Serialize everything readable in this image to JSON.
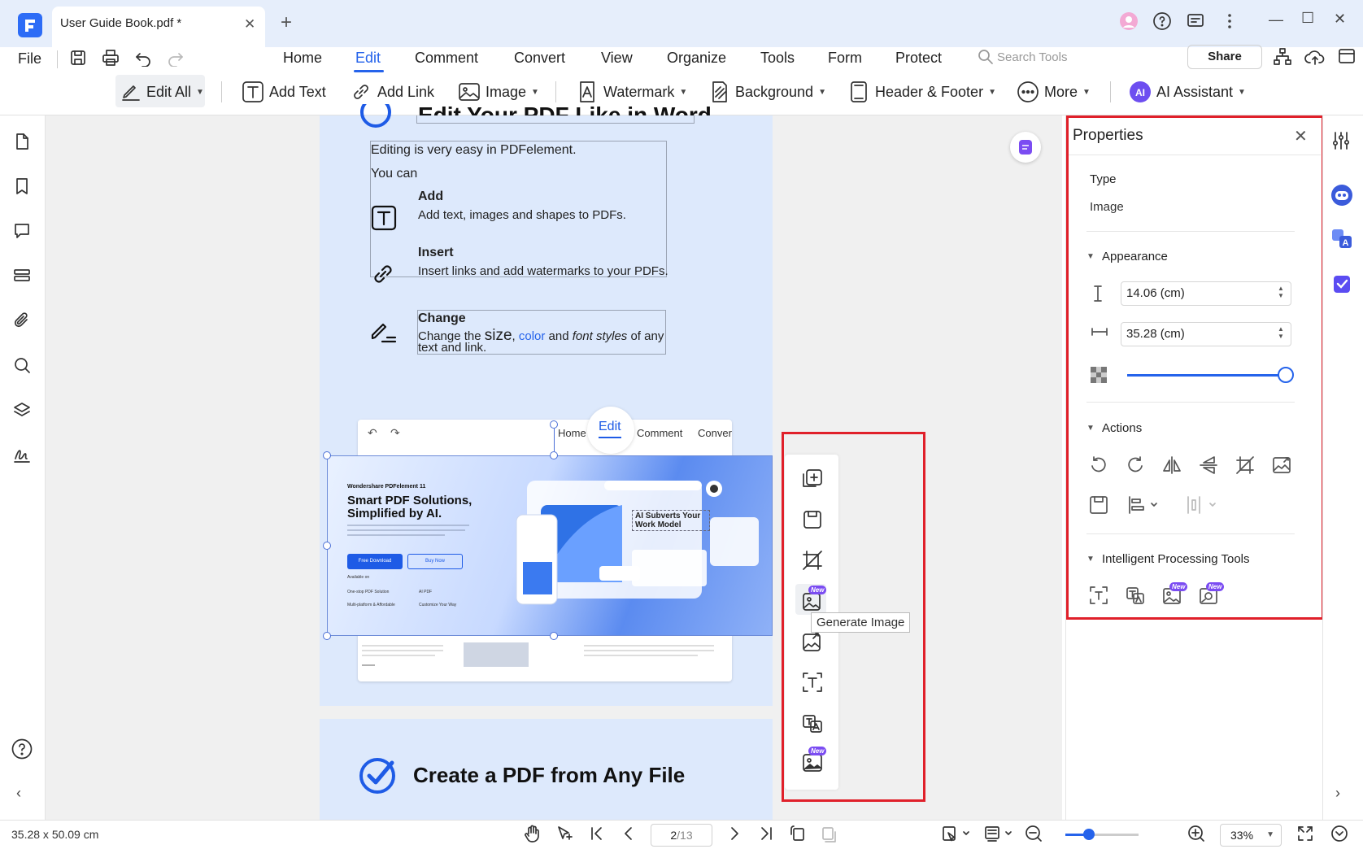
{
  "tab": {
    "title": "User Guide Book.pdf *",
    "close": "✕",
    "add": "+"
  },
  "window": {
    "minimize": "—",
    "maximize": "☐",
    "close": "✕"
  },
  "menubar": {
    "file": "File",
    "items": [
      "Home",
      "Edit",
      "Comment",
      "Convert",
      "View",
      "Organize",
      "Tools",
      "Form",
      "Protect"
    ],
    "active": "Edit",
    "search_placeholder": "Search Tools",
    "share": "Share"
  },
  "ribbon": {
    "edit_all": "Edit All",
    "add_text": "Add Text",
    "add_link": "Add Link",
    "image": "Image",
    "watermark": "Watermark",
    "background": "Background",
    "header_footer": "Header & Footer",
    "more": "More",
    "ai_assistant": "AI Assistant"
  },
  "page": {
    "heading_partial": "Edit Your PDF Like in Word",
    "intro1": "Editing is very easy in PDFelement.",
    "intro2": "You can",
    "add_title": "Add",
    "add_desc": "Add text, images and shapes to PDFs.",
    "insert_title": "Insert",
    "insert_desc": "Insert links and add watermarks to your PDFs.",
    "change_title": "Change",
    "change_pre": "Change the ",
    "change_size": "size",
    "change_comma": ", ",
    "change_color": "color",
    "change_and": " and ",
    "change_font": "font styles",
    "change_post": " of any",
    "change_line2": "text and link.",
    "mini_tabs": [
      "Home",
      "Edit",
      "Comment",
      "Convert"
    ],
    "banner": {
      "brand": "Wondershare PDFelement 11",
      "headline1": "Smart PDF Solutions,",
      "headline2": "Simplified by AI.",
      "free_download": "Free Download",
      "buy_now": "Buy Now",
      "available_on": "Available on",
      "feature1": "One-stop PDF Solution",
      "feature2": "AI PDF",
      "feature3": "Multi-platform & Affordable",
      "feature4": "Customize Your Way",
      "callout": "AI Subverts Your Work Model"
    },
    "page2_heading": "Create a PDF from Any File"
  },
  "float_toolbar": {
    "tooltip": "Generate Image",
    "new_badge": "New",
    "items": [
      "add-image",
      "save-image",
      "crop",
      "generate-image",
      "replace-image",
      "ocr-text",
      "translate-image",
      "ai-image"
    ]
  },
  "properties": {
    "title": "Properties",
    "close": "✕",
    "type_label": "Type",
    "type_value": "Image",
    "appearance": "Appearance",
    "height_value": "14.06 (cm)",
    "width_value": "35.28 (cm)",
    "opacity": 1.0,
    "actions": "Actions",
    "intelligent": "Intelligent Processing Tools",
    "new_badge": "New"
  },
  "statusbar": {
    "dimensions": "35.28 x 50.09 cm",
    "page_current": "2",
    "page_total": "/13",
    "zoom": "33%"
  },
  "colors": {
    "accent": "#2563eb",
    "highlight_red": "#e0202a",
    "page_bg": "#dde9fc",
    "new_badge": "#7b4cf2"
  }
}
